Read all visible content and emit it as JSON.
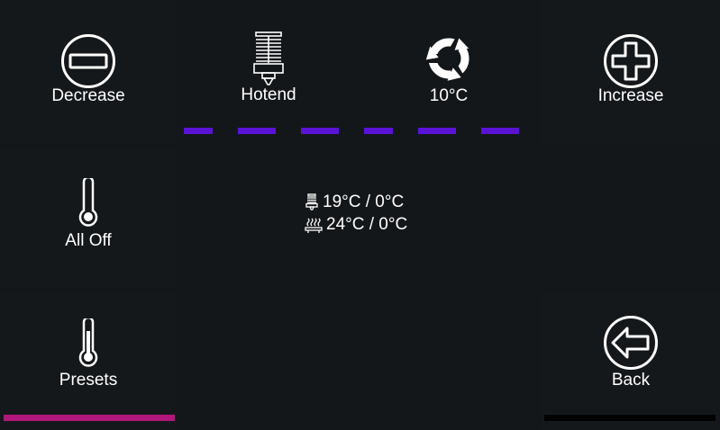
{
  "top_row": {
    "decrease_label": "Decrease",
    "tool_label": "Hotend",
    "step_label": "10°C",
    "increase_label": "Increase"
  },
  "left_column": {
    "all_off_label": "All Off",
    "presets_label": "Presets"
  },
  "status": {
    "hotend_temp": "19°C / 0°C",
    "bed_temp": "24°C / 0°C"
  },
  "back_label": "Back",
  "colors": {
    "background": "#14171a",
    "dash_accent": "#5a13d6",
    "presets_bar": "#b0177a",
    "back_bar": "#000000"
  },
  "icons": {
    "decrease": "minus-circle-icon",
    "hotend": "hotend-icon",
    "step": "refresh-icon",
    "increase": "plus-circle-icon",
    "all_off": "thermometer-empty-icon",
    "presets": "thermometer-half-icon",
    "back": "back-arrow-circle-icon",
    "hotend_small": "hotend-small-icon",
    "bed_small": "heated-bed-icon"
  }
}
